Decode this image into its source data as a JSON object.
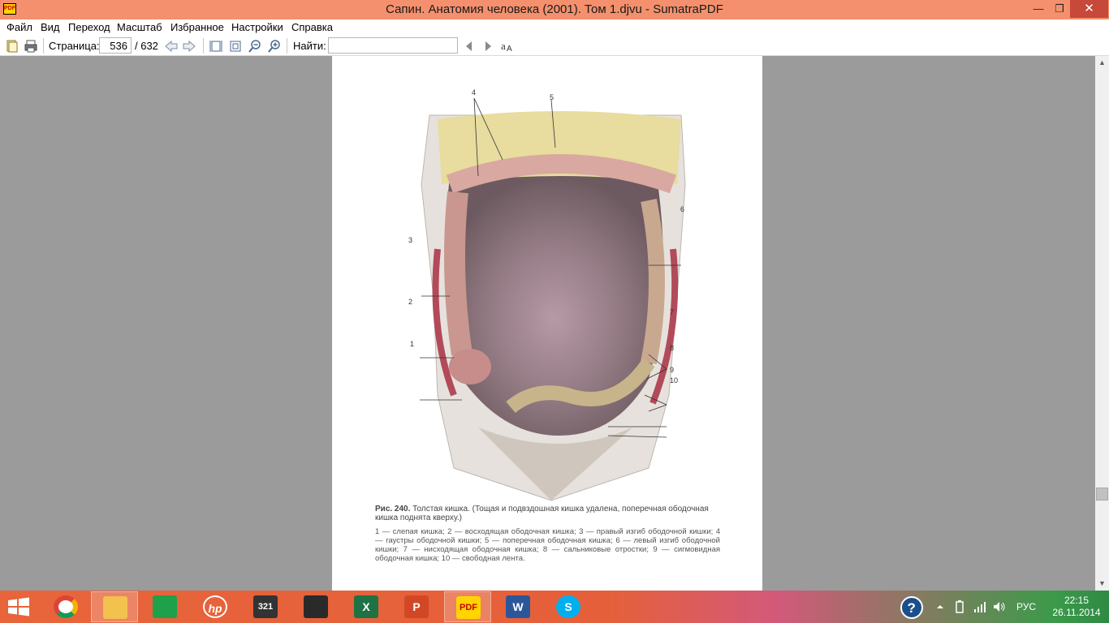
{
  "window": {
    "title": "Сапин. Анатомия человека (2001). Том 1.djvu - SumatraPDF",
    "app_icon_text": "PDF"
  },
  "menu": [
    "Файл",
    "Вид",
    "Переход",
    "Масштаб",
    "Избранное",
    "Настройки",
    "Справка"
  ],
  "toolbar": {
    "page_label": "Страница:",
    "page_current": "536",
    "page_total": "/ 632",
    "find_label": "Найти:",
    "find_value": ""
  },
  "document": {
    "callouts": [
      "4",
      "5",
      "6",
      "3",
      "2",
      "7",
      "1",
      "8",
      "9",
      "10"
    ],
    "caption_title": "Рис. 240.",
    "caption_text": " Толстая кишка. (Тощая и подвздошная кишка удалена, поперечная ободочная кишка поднята кверху.)",
    "legend": "1 — слепая кишка; 2 — восходящая ободочная кишка; 3 — правый изгиб ободочной кишки; 4 — гаустры ободочной кишки; 5 — поперечная ободочная кишка; 6 — левый изгиб ободочной кишки; 7 — нисходящая ободочная кишка; 8 — сальниковые отростки; 9 — сигмовидная ободочная кишка; 10 — свободная лента."
  },
  "taskbar": {
    "apps": [
      {
        "name": "chrome",
        "icon": "chrome-icon",
        "color": "#4285f4"
      },
      {
        "name": "explorer",
        "icon": "folder-icon",
        "color": "#f2c14e"
      },
      {
        "name": "store",
        "icon": "store-icon",
        "color": "#1ea14a"
      },
      {
        "name": "hp",
        "icon": "hp-icon",
        "color": "#0096d6"
      },
      {
        "name": "media-player",
        "icon": "film-icon",
        "color": "#333333"
      },
      {
        "name": "app",
        "icon": "app-icon",
        "color": "#2a2a2a"
      },
      {
        "name": "excel",
        "icon": "excel-icon",
        "color": "#1f7244"
      },
      {
        "name": "powerpoint",
        "icon": "powerpoint-icon",
        "color": "#d24726"
      },
      {
        "name": "sumatrapdf",
        "icon": "sumatra-icon",
        "color": "#ffd400"
      },
      {
        "name": "word",
        "icon": "word-icon",
        "color": "#2b579a"
      },
      {
        "name": "skype",
        "icon": "skype-icon",
        "color": "#00aff0"
      }
    ],
    "language": "РУС",
    "time": "22:15",
    "date": "26.11.2014"
  }
}
